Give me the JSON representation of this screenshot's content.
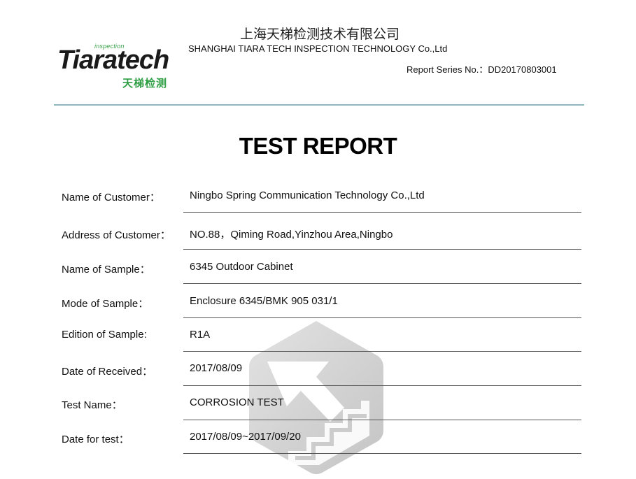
{
  "header": {
    "logo": {
      "wordmark": "Tiaratech",
      "tagline": "inspection",
      "cn_mark": "天梯检测"
    },
    "company_cn": "上海天梯检测技术有限公司",
    "company_en": "SHANGHAI TIARA TECH INSPECTION TECHNOLOGY Co.,Ltd",
    "report_series": "Report Series No.：DD20170803001"
  },
  "title": "TEST REPORT",
  "fields": [
    {
      "label": "Name of Customer：",
      "value": "Ningbo Spring Communication Technology Co.,Ltd"
    },
    {
      "label": "Address of Customer：",
      "value": "NO.88，Qiming Road,Yinzhou Area,Ningbo"
    },
    {
      "label": "Name of Sample：",
      "value": "6345 Outdoor Cabinet"
    },
    {
      "label": "Mode of Sample：",
      "value": "Enclosure 6345/BMK 905 031/1"
    },
    {
      "label": "Edition of Sample:",
      "value": "R1A"
    },
    {
      "label": "Date of Received：",
      "value": "2017/08/09"
    },
    {
      "label": "Test Name：",
      "value": "CORROSION TEST"
    },
    {
      "label": "Date for test：",
      "value": "2017/08/09~2017/09/20"
    }
  ],
  "colors": {
    "header_rule": "#8fb6bd",
    "brand_green": "#2f9e44",
    "watermark_gray": "#9a9a9a"
  },
  "icons": {
    "watermark": "tiaratech-stair-arrow-watermark"
  }
}
